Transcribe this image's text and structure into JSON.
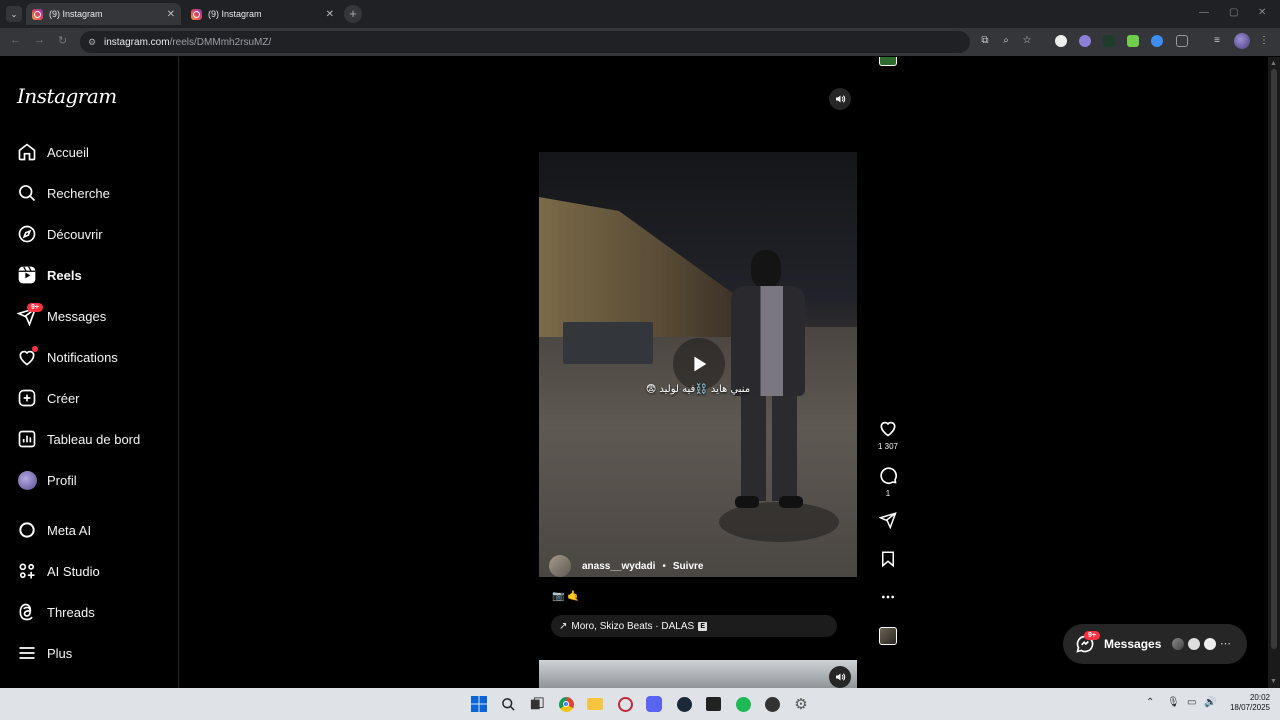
{
  "browser": {
    "tabs": [
      {
        "title": "(9) Instagram",
        "active": true
      },
      {
        "title": "(9) Instagram",
        "active": false
      }
    ],
    "url_host": "instagram.com",
    "url_path": "/reels/DMMmh2rsuMZ/"
  },
  "sidebar": {
    "logo": "Instagram",
    "items": [
      {
        "label": "Accueil",
        "icon": "home-icon"
      },
      {
        "label": "Recherche",
        "icon": "search-icon"
      },
      {
        "label": "Découvrir",
        "icon": "compass-icon"
      },
      {
        "label": "Reels",
        "icon": "reels-icon"
      },
      {
        "label": "Messages",
        "icon": "messenger-icon",
        "badge": "9+"
      },
      {
        "label": "Notifications",
        "icon": "heart-icon"
      },
      {
        "label": "Créer",
        "icon": "create-icon"
      },
      {
        "label": "Tableau de bord",
        "icon": "dashboard-icon"
      },
      {
        "label": "Profil",
        "icon": "avatar"
      },
      {
        "label": "Meta AI",
        "icon": "meta-ai-icon"
      },
      {
        "label": "AI Studio",
        "icon": "ai-studio-icon"
      },
      {
        "label": "Threads",
        "icon": "threads-icon"
      },
      {
        "label": "Plus",
        "icon": "menu-icon"
      }
    ]
  },
  "reel": {
    "overlay_caption": "منبي هايد ⛓️فيه لوليد 😨",
    "author": "anass__wydadi",
    "separator": "•",
    "follow_label": "Suivre",
    "description": "📷 🤙",
    "audio_arrow": "↗",
    "audio": "Moro, Skizo Beats · DALAS",
    "explicit": "E",
    "likes": "1 307",
    "comments": "1"
  },
  "messages_float": {
    "label": "Messages",
    "badge": "9+"
  },
  "taskbar": {
    "time": "20:02",
    "date": "18/07/2025"
  },
  "colors": {
    "background": "#000000",
    "badge": "#ff3040",
    "chrome_dark": "#202124",
    "taskbar": "#dfe3e8"
  }
}
